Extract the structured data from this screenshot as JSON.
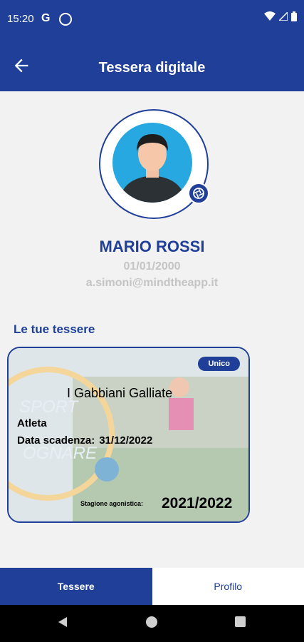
{
  "statusbar": {
    "time": "15:20"
  },
  "header": {
    "title": "Tessera digitale"
  },
  "profile": {
    "name": "MARIO ROSSI",
    "dob": "01/01/2000",
    "email": "a.simoni@mindtheapp.it"
  },
  "section_title": "Le tue tessere",
  "card": {
    "badge": "Unico",
    "club": "I Gabbiani Galliate",
    "role": "Atleta",
    "expiry_label": "Data scadenza:",
    "expiry_value": "31/12/2022",
    "season_label": "Stagione agonistica:",
    "season_value": "2021/2022"
  },
  "tabs": [
    {
      "label": "Tessere"
    },
    {
      "label": "Profilo"
    }
  ],
  "colors": {
    "primary": "#1f3f99",
    "avatar_bg": "#27a8e0"
  }
}
